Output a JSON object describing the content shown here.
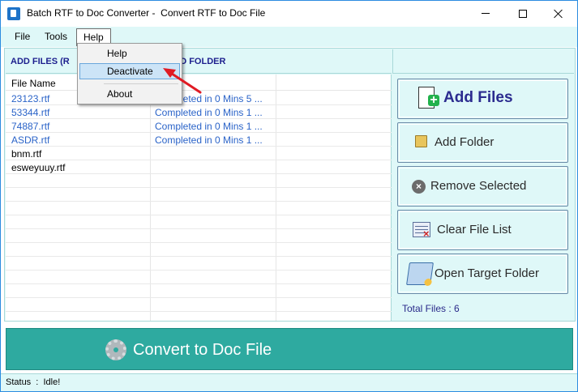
{
  "window": {
    "title": "Batch RTF to Doc Converter -  Convert RTF to Doc File"
  },
  "menubar": {
    "file": "File",
    "tools": "Tools",
    "help": "Help"
  },
  "help_menu": {
    "items": [
      "Help",
      "Deactivate",
      "About"
    ],
    "highlighted": "Deactivate"
  },
  "files_panel": {
    "header": "ADD FILES (R                      FILES OR ADD FOLDER",
    "columns": {
      "name": "File Name",
      "status": ""
    },
    "rows": [
      {
        "name": "23123.rtf",
        "status": "Completed in 0 Mins 5 ..."
      },
      {
        "name": "53344.rtf",
        "status": "Completed in 0 Mins 1 ..."
      },
      {
        "name": "74887.rtf",
        "status": "Completed in 0 Mins 1 ..."
      },
      {
        "name": "ASDR.rtf",
        "status": "Completed in 0 Mins 1 ..."
      },
      {
        "name": "bnm.rtf",
        "status": ""
      },
      {
        "name": "esweyuuy.rtf",
        "status": ""
      }
    ]
  },
  "side_buttons": {
    "add_files": "Add Files",
    "add_folder": "Add Folder",
    "remove_selected": "Remove Selected",
    "clear_file_list": "Clear File List",
    "open_target_folder": "Open Target Folder"
  },
  "total_files": "Total Files : 6",
  "convert_button": "Convert to Doc File",
  "status": "Status  :  Idle!",
  "colors": {
    "panel_bg": "#dff8f8",
    "convert_bg": "#2eaaa0",
    "link_blue": "#2a63c8",
    "header_text": "#1d1f8e",
    "annotation_red": "#e01b24"
  }
}
